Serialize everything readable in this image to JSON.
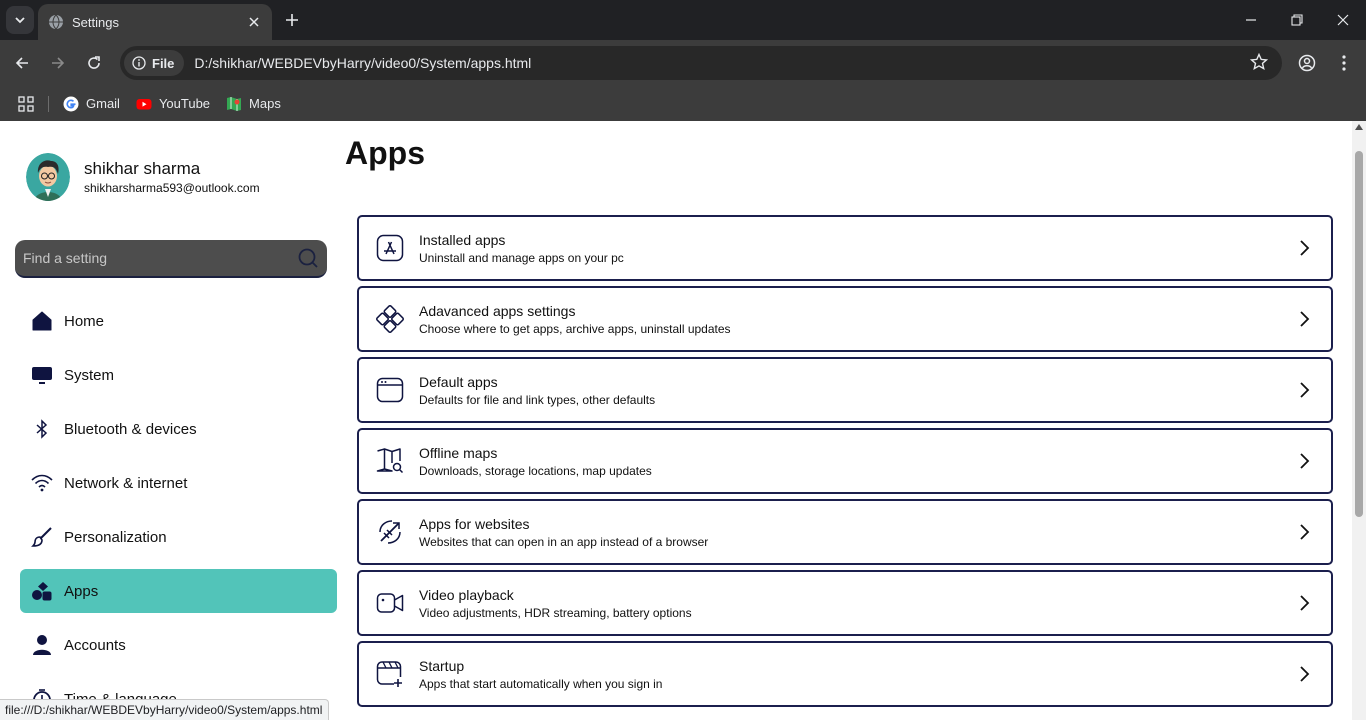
{
  "browser": {
    "tab_title": "Settings",
    "address_chip": "File",
    "url": "D:/shikhar/WEBDEVbyHarry/video0/System/apps.html",
    "bookmarks": [
      {
        "label": "Gmail",
        "icon": "gmail-icon"
      },
      {
        "label": "YouTube",
        "icon": "youtube-icon"
      },
      {
        "label": "Maps",
        "icon": "maps-icon"
      }
    ],
    "status_text": "file:///D:/shikhar/WEBDEVbyHarry/video0/System/apps.html"
  },
  "profile": {
    "name": "shikhar sharma",
    "email": "shikharsharma593@outlook.com"
  },
  "search": {
    "placeholder": "Find a setting"
  },
  "sidebar": {
    "items": [
      {
        "label": "Home",
        "icon": "home-icon"
      },
      {
        "label": "System",
        "icon": "monitor-icon"
      },
      {
        "label": "Bluetooth & devices",
        "icon": "bluetooth-icon"
      },
      {
        "label": "Network & internet",
        "icon": "wifi-icon"
      },
      {
        "label": "Personalization",
        "icon": "brush-icon"
      },
      {
        "label": "Apps",
        "icon": "apps-icon",
        "active": true
      },
      {
        "label": "Accounts",
        "icon": "person-icon"
      },
      {
        "label": "Time & language",
        "icon": "clock-icon"
      }
    ]
  },
  "main": {
    "heading": "Apps",
    "cards": [
      {
        "title": "Installed apps",
        "desc": "Uninstall and manage apps on your pc",
        "icon": "app-store-icon"
      },
      {
        "title": "Adavanced apps settings",
        "desc": "Choose where to get apps, archive apps, uninstall updates",
        "icon": "advanced-apps-icon"
      },
      {
        "title": "Default apps",
        "desc": "Defaults for file and link types, other defaults",
        "icon": "window-icon"
      },
      {
        "title": "Offline maps",
        "desc": "Downloads, storage locations, map updates",
        "icon": "map-search-icon"
      },
      {
        "title": "Apps for websites",
        "desc": "Websites that can open in an app instead of a browser",
        "icon": "website-app-icon"
      },
      {
        "title": "Video playback",
        "desc": "Video adjustments, HDR streaming, battery options",
        "icon": "video-icon"
      },
      {
        "title": "Startup",
        "desc": "Apps that start automatically when you sign in",
        "icon": "startup-icon"
      }
    ]
  },
  "colors": {
    "accent": "#52c4b9",
    "card_border": "#1b1f4d",
    "icon_navy": "#0f1440"
  }
}
